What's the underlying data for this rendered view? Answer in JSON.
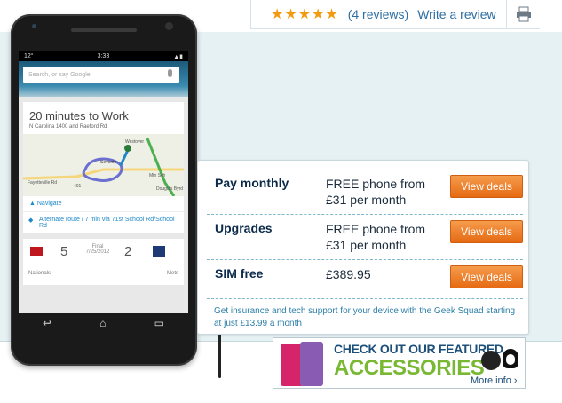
{
  "topbar": {
    "stars": "★★★★★",
    "reviews_label": "(4 reviews)",
    "write_review_label": "Write a review",
    "print_icon": "printer-icon"
  },
  "phone": {
    "status_time": "3:33",
    "status_left": "12°",
    "search_placeholder": "Search, or say Google",
    "route_title_pre": "20 minutes",
    "route_title_post": " to Work",
    "route_sub": "N Carolina 1400 and Raeford Rd",
    "navigate_label": "Navigate",
    "alt_route_label": "Alternate route / 7 min via 71st School Rd/School Rd",
    "score_home": "5",
    "score_away": "2",
    "score_final": "Final",
    "score_date": "7/25/2012",
    "team_home": "Nationals",
    "team_away": "Mets",
    "map_labels": [
      "Westover",
      "Seventy",
      "Fayetteville Rd",
      "Douglas Byrd",
      "Mtn Sch",
      "401"
    ]
  },
  "deals": {
    "rows": [
      {
        "name": "Pay monthly",
        "price": "FREE phone from £31 per month",
        "button": "View deals"
      },
      {
        "name": "Upgrades",
        "price": "FREE phone from £31 per month",
        "button": "View deals"
      },
      {
        "name": "SIM free",
        "price": "£389.95",
        "button": "View deals"
      }
    ],
    "note": "Get insurance and tech support for your device with the Geek Squad starting at just  £13.99 a month"
  },
  "accessories": {
    "line1": "CHECK OUT OUR FEATURED",
    "line2": "ACCESSORIES",
    "more": "More info ›"
  },
  "colors": {
    "accent_orange": "#e66a13",
    "star": "#f29b12",
    "link": "#2c6fa3",
    "panel_bg": "#e6f1f4",
    "accessories_green": "#78b832"
  }
}
